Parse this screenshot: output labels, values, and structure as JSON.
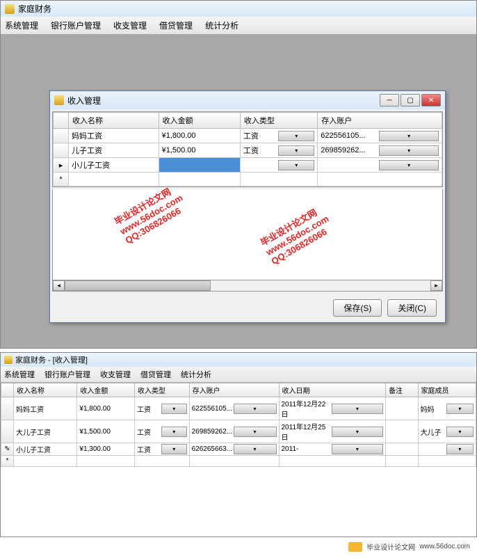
{
  "main_window": {
    "title": "家庭财务",
    "menu": [
      "系统管理",
      "银行账户管理",
      "收支管理",
      "借贷管理",
      "统计分析"
    ]
  },
  "dialog": {
    "title": "收入管理",
    "columns": [
      "收入名称",
      "收入金额",
      "收入类型",
      "存入账户"
    ],
    "rows": [
      {
        "name": "妈妈工资",
        "amount": "¥1,800.00",
        "type": "工资",
        "account": "622556105..."
      },
      {
        "name": "儿子工资",
        "amount": "¥1,500.00",
        "type": "工资",
        "account": "269859262..."
      },
      {
        "name": "小儿子工资",
        "amount": "",
        "type": "",
        "account": "",
        "editing": true
      }
    ],
    "save": "保存(S)",
    "close": "关闭(C)"
  },
  "watermark": {
    "line1": "毕业设计论文网",
    "line2": "www.56doc.com",
    "line3": "QQ:306826066"
  },
  "window2": {
    "title": "家庭财务 - [收入管理]",
    "menu": [
      "系统管理",
      "银行账户管理",
      "收支管理",
      "借贷管理",
      "统计分析"
    ],
    "columns": [
      "收入名称",
      "收入金额",
      "收入类型",
      "存入账户",
      "收入日期",
      "备注",
      "家庭成员"
    ],
    "rows": [
      {
        "name": "妈妈工资",
        "amount": "¥1,800.00",
        "type": "工资",
        "account": "622556105...",
        "date": "2011年12月22日",
        "note": "",
        "member": "妈妈"
      },
      {
        "name": "大儿子工资",
        "amount": "¥1,500.00",
        "type": "工资",
        "account": "269859262...",
        "date": "2011年12月25日",
        "note": "",
        "member": "大儿子"
      },
      {
        "name": "小儿子工资",
        "amount": "¥1,300.00",
        "type": "工资",
        "account": "626265663...",
        "date": "2011-",
        "note": "",
        "member": ""
      }
    ]
  },
  "footer_text": "毕业设计论文网",
  "footer_url": "www.56doc.com"
}
